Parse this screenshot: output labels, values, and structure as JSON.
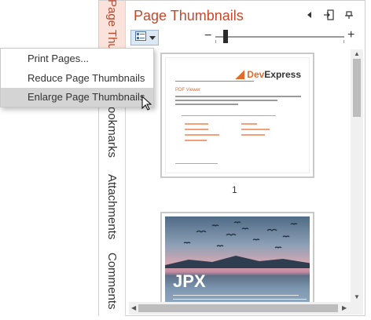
{
  "sidebar_tabs": [
    "Page Thumbnails",
    "Bookmarks",
    "Attachments",
    "Comments"
  ],
  "panel": {
    "title": "Page Thumbnails",
    "header_icons": [
      "collapse-left-icon",
      "dock-icon",
      "pin-icon"
    ],
    "menu_button_icon": "thumbnail-menu-icon",
    "zoom": {
      "minus": "−",
      "plus": "+",
      "level": 0.1
    }
  },
  "context_menu": {
    "items": [
      "Print Pages...",
      "Reduce Page Thumbnails",
      "Enlarge Page Thumbnails"
    ],
    "hovered": "Enlarge Page Thumbnails"
  },
  "thumbnails": {
    "page1": {
      "logo_prefix": "Dev",
      "logo_suffix": "Express",
      "heading": "PDF Viewer",
      "number": "1"
    },
    "page2": {
      "heading": "JPX"
    }
  },
  "colors": {
    "accent": "#c5492b",
    "menu_hover": "#d4d4d4",
    "tab_active_bg": "#fbe3dc"
  }
}
